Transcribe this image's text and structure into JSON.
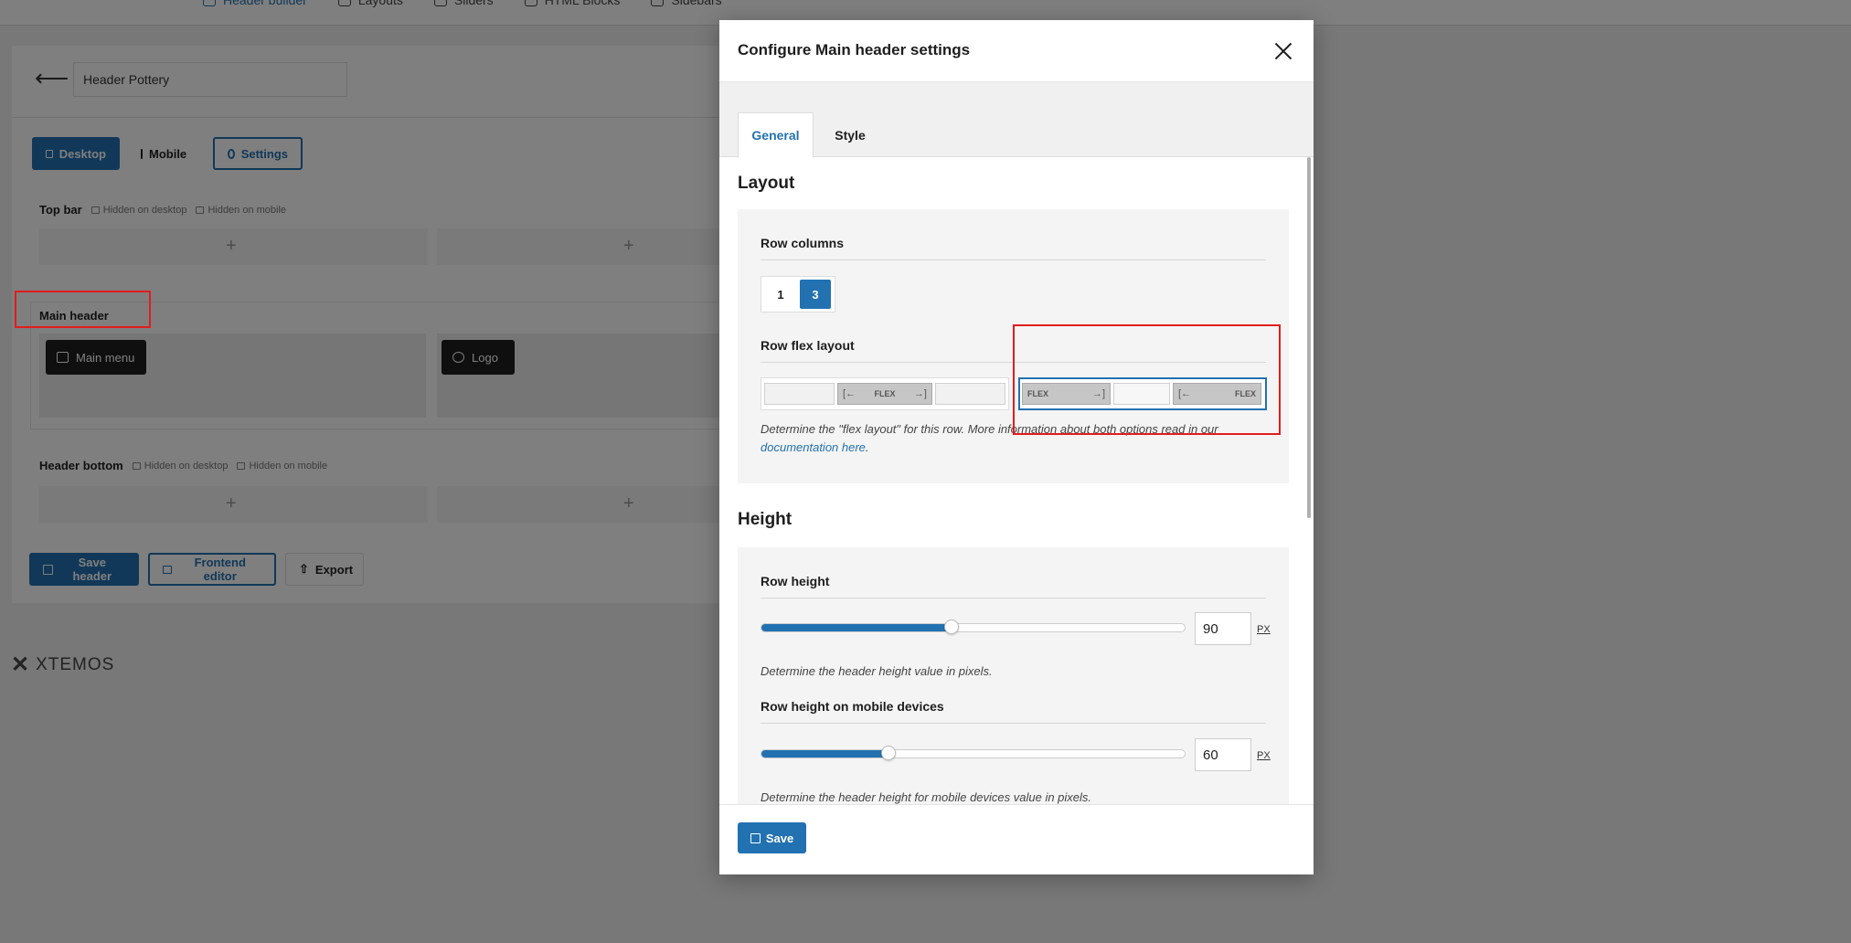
{
  "topnav": {
    "items": [
      {
        "label": "Header builder",
        "icon": "header-icon"
      },
      {
        "label": "Layouts",
        "icon": "layers-icon"
      },
      {
        "label": "Sliders",
        "icon": "slider-icon"
      },
      {
        "label": "HTML Blocks",
        "icon": "html-block-icon"
      },
      {
        "label": "Sidebars",
        "icon": "sidebar-icon"
      }
    ]
  },
  "builder": {
    "header_name": "Header Pottery",
    "devices": {
      "desktop": "Desktop",
      "mobile": "Mobile",
      "settings": "Settings"
    },
    "top_bar": {
      "title": "Top bar",
      "hidden_desktop": "Hidden on desktop",
      "hidden_mobile": "Hidden on mobile"
    },
    "main_header": {
      "title": "Main header",
      "items": [
        "Main menu",
        "Logo"
      ]
    },
    "header_bottom": {
      "title": "Header bottom",
      "hidden_desktop": "Hidden on desktop",
      "hidden_mobile": "Hidden on mobile"
    },
    "buttons": {
      "save": "Save header",
      "frontend": "Frontend editor",
      "export": "Export"
    },
    "brand": "XTEMOS"
  },
  "modal": {
    "title": "Configure Main header settings",
    "tabs": [
      "General",
      "Style"
    ],
    "active_tab": "General",
    "layout": {
      "title": "Layout",
      "row_columns": {
        "label": "Row columns",
        "options": [
          "1",
          "3"
        ],
        "selected": "3"
      },
      "row_flex_layout": {
        "label": "Row flex layout",
        "flex_label": "FLEX",
        "selected_option": 2,
        "description": "Determine the \"flex layout\" for this row. More information about both options read in our ",
        "link": "documentation here",
        "description_end": "."
      }
    },
    "height": {
      "title": "Height",
      "row_height": {
        "label": "Row height",
        "value": "90",
        "unit": "PX",
        "slider_percent": 45,
        "description": "Determine the header height value in pixels."
      },
      "row_height_mobile": {
        "label": "Row height on mobile devices",
        "value": "60",
        "unit": "PX",
        "slider_percent": 30,
        "description": "Determine the header height for mobile devices value in pixels."
      }
    },
    "save": "Save"
  },
  "colors": {
    "accent": "#2271b1",
    "highlight": "#e11d1d"
  }
}
